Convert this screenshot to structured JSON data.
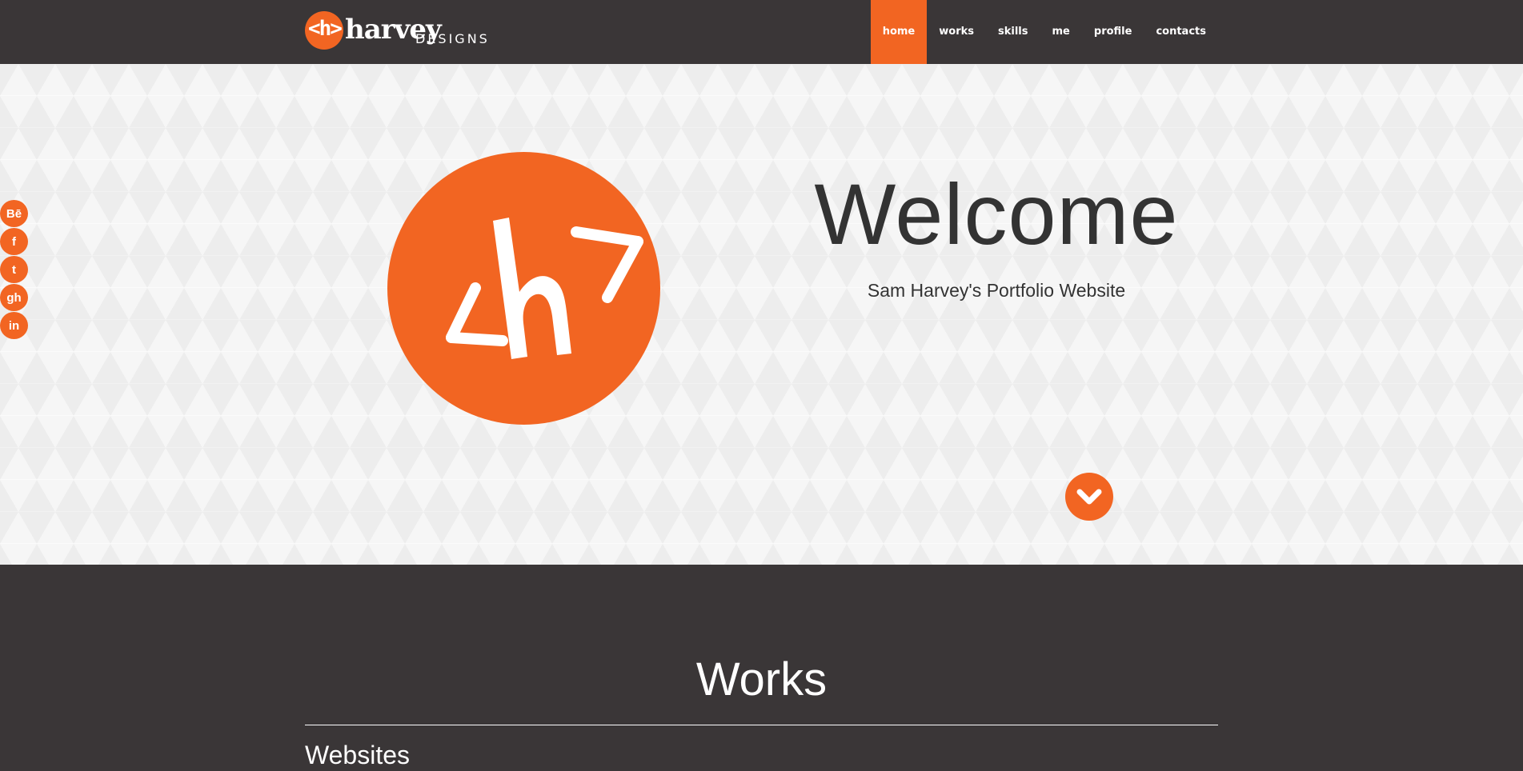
{
  "navbar": {
    "logo": {
      "mark": "<h>",
      "word": "harvey",
      "sub": "DESIGNS"
    },
    "items": [
      {
        "label": "home",
        "active": true
      },
      {
        "label": "works",
        "active": false
      },
      {
        "label": "skills",
        "active": false
      },
      {
        "label": "me",
        "active": false
      },
      {
        "label": "profile",
        "active": false
      },
      {
        "label": "contacts",
        "active": false
      }
    ]
  },
  "hero": {
    "title": "Welcome",
    "subtitle": "Sam Harvey's Portfolio Website",
    "scroll_icon": "chevron-down-icon"
  },
  "social": [
    {
      "name": "behance",
      "label": "Bē"
    },
    {
      "name": "facebook",
      "label": "f"
    },
    {
      "name": "twitter",
      "label": "t"
    },
    {
      "name": "github",
      "label": "gh"
    },
    {
      "name": "linkedin",
      "label": "in"
    }
  ],
  "works": {
    "title": "Works",
    "section": "Websites"
  },
  "colors": {
    "accent": "#f26522",
    "dark": "#3a3637",
    "hero_bg": "#f6f6f6",
    "text_dark": "#333333"
  }
}
